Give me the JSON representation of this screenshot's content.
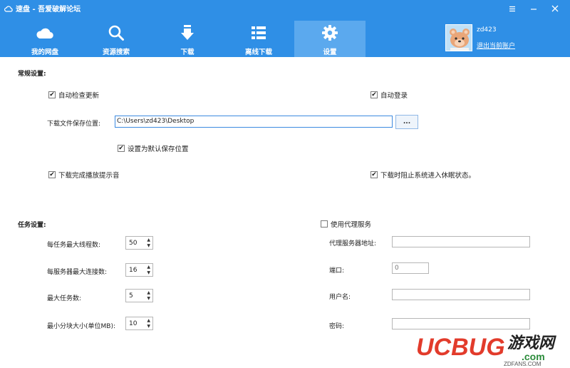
{
  "window": {
    "title": "速盘 - 吾爱破解论坛"
  },
  "nav": {
    "items": [
      {
        "label": "我的网盘",
        "icon": "cloud-icon"
      },
      {
        "label": "资源搜索",
        "icon": "search-icon"
      },
      {
        "label": "下载",
        "icon": "download-icon"
      },
      {
        "label": "离线下载",
        "icon": "list-icon"
      },
      {
        "label": "设置",
        "icon": "gear-icon",
        "active": true
      }
    ]
  },
  "user": {
    "name": "zd423",
    "logout_label": "退出当前账户"
  },
  "general": {
    "title": "常规设置:",
    "auto_update": {
      "label": "自动检查更新",
      "checked": true
    },
    "auto_login": {
      "label": "自动登录",
      "checked": true
    },
    "save_path_label": "下载文件保存位置:",
    "save_path_value": "C:\\Users\\zd423\\Desktop",
    "browse_label": "...",
    "set_default": {
      "label": "设置为默认保存位置",
      "checked": true
    },
    "play_sound": {
      "label": "下载完成播放提示音",
      "checked": true
    },
    "prevent_sleep": {
      "label": "下载时阻止系统进入休眠状态。",
      "checked": true
    }
  },
  "tasks": {
    "title": "任务设置:",
    "max_threads": {
      "label": "每任务最大线程数:",
      "value": "50"
    },
    "max_connections": {
      "label": "每服务器最大连接数:",
      "value": "16"
    },
    "max_tasks": {
      "label": "最大任务数:",
      "value": "5"
    },
    "min_block": {
      "label": "最小分块大小(单位MB):",
      "value": "10"
    }
  },
  "proxy": {
    "enable": {
      "label": "使用代理服务",
      "checked": false
    },
    "server_label": "代理服务器地址:",
    "server_value": "",
    "port_label": "端口:",
    "port_value": "0",
    "user_label": "用户名:",
    "user_value": "",
    "password_label": "密码:",
    "password_value": ""
  },
  "watermark": {
    "brand": "UCBUG",
    "sub": "游戏网",
    "domain": ".com",
    "url": "ZDFANS.COM"
  },
  "colors": {
    "header": "#2f8fe6",
    "nav_active": "#5ba9ee",
    "input_focus": "#3d8ae0"
  }
}
